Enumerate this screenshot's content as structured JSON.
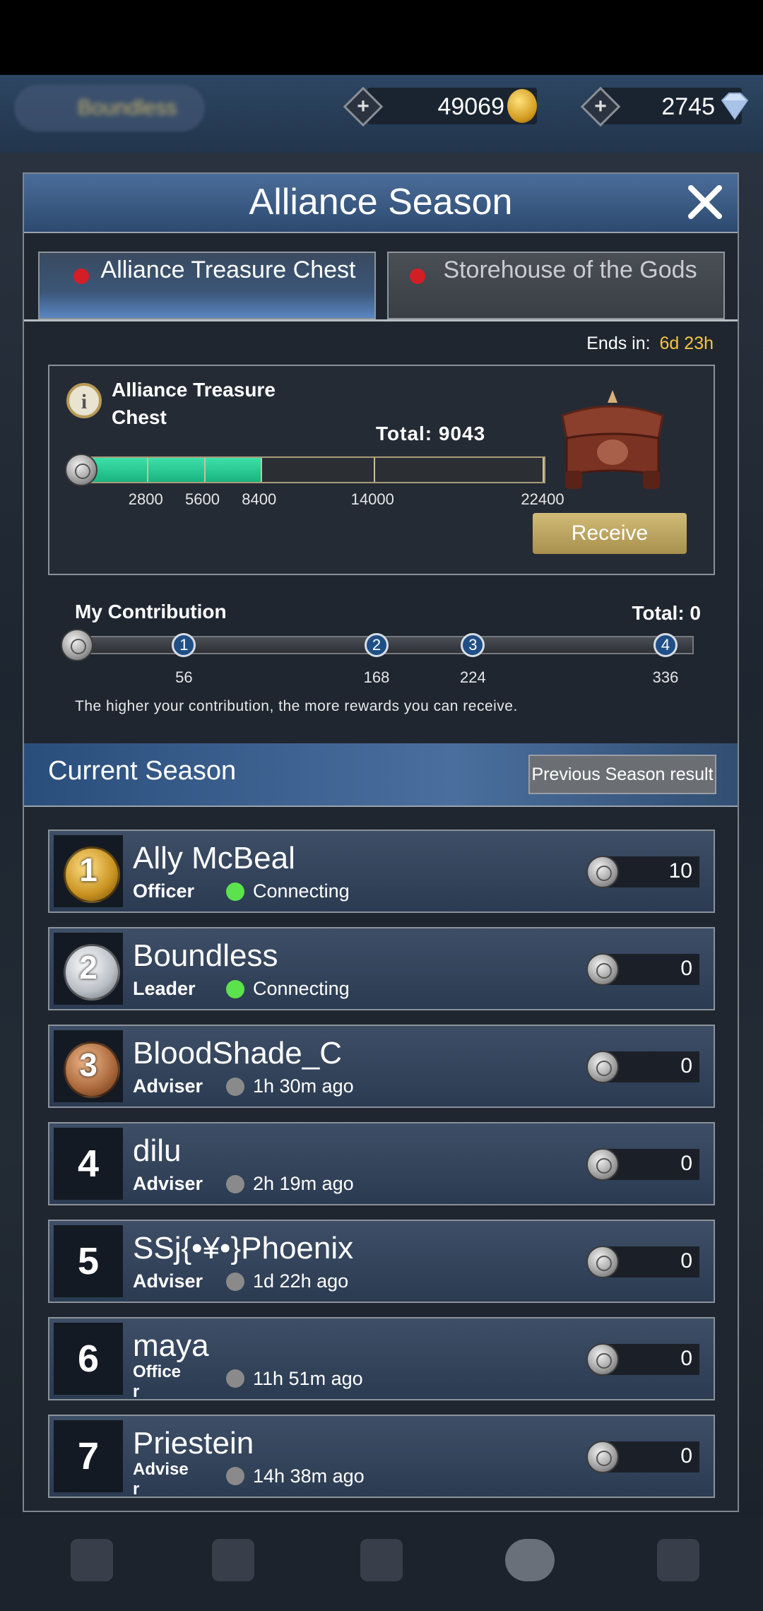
{
  "header": {
    "username": "Boundless",
    "gold": "49069",
    "gems": "2745"
  },
  "dialog": {
    "title": "Alliance Season",
    "tabs": [
      {
        "label": "Alliance Treasure Chest",
        "active": true
      },
      {
        "label": "Storehouse of the Gods",
        "active": false
      }
    ],
    "ends_label": "Ends in:",
    "ends_value": "6d 23h",
    "chest": {
      "title": "Alliance Treasure Chest",
      "total_label": "Total: 9043",
      "total_value": 9043,
      "max_value": 22400,
      "ticks": [
        "2800",
        "5600",
        "8400",
        "14000",
        "22400"
      ],
      "receive_label": "Receive"
    },
    "contribution": {
      "title": "My Contribution",
      "total_label": "Total: 0",
      "milestones": [
        {
          "badge": "1",
          "value": "56"
        },
        {
          "badge": "2",
          "value": "168"
        },
        {
          "badge": "3",
          "value": "224"
        },
        {
          "badge": "4",
          "value": "336"
        }
      ],
      "hint": "The higher your contribution, the more rewards you can receive."
    },
    "season": {
      "title": "Current Season",
      "prev_button": "Previous Season result"
    },
    "members": [
      {
        "rank": "1",
        "name": "Ally McBeal",
        "role": "Officer",
        "status": "Connecting",
        "online": true,
        "score": "10"
      },
      {
        "rank": "2",
        "name": "Boundless",
        "role": "Leader",
        "status": "Connecting",
        "online": true,
        "score": "0"
      },
      {
        "rank": "3",
        "name": "BloodShade_C",
        "role": "Adviser",
        "status": "1h 30m  ago",
        "online": false,
        "score": "0"
      },
      {
        "rank": "4",
        "name": "dilu",
        "role": "Adviser",
        "status": "2h 19m  ago",
        "online": false,
        "score": "0"
      },
      {
        "rank": "5",
        "name": "SSj{•¥•}Phoenix",
        "role": "Adviser",
        "status": "1d 22h  ago",
        "online": false,
        "score": "0"
      },
      {
        "rank": "6",
        "name": "maya",
        "role": "Office\nr",
        "status": "11h 51m  ago",
        "online": false,
        "score": "0"
      },
      {
        "rank": "7",
        "name": "Priestein",
        "role": "Advise\nr",
        "status": "14h 38m  ago",
        "online": false,
        "score": "0"
      }
    ]
  },
  "colors": {
    "accent_gold": "#f5c542",
    "online": "#5be24d",
    "offline": "#8a8a8a",
    "tab_dot": "#d41e26",
    "progress_fill": "#2ad39a"
  }
}
